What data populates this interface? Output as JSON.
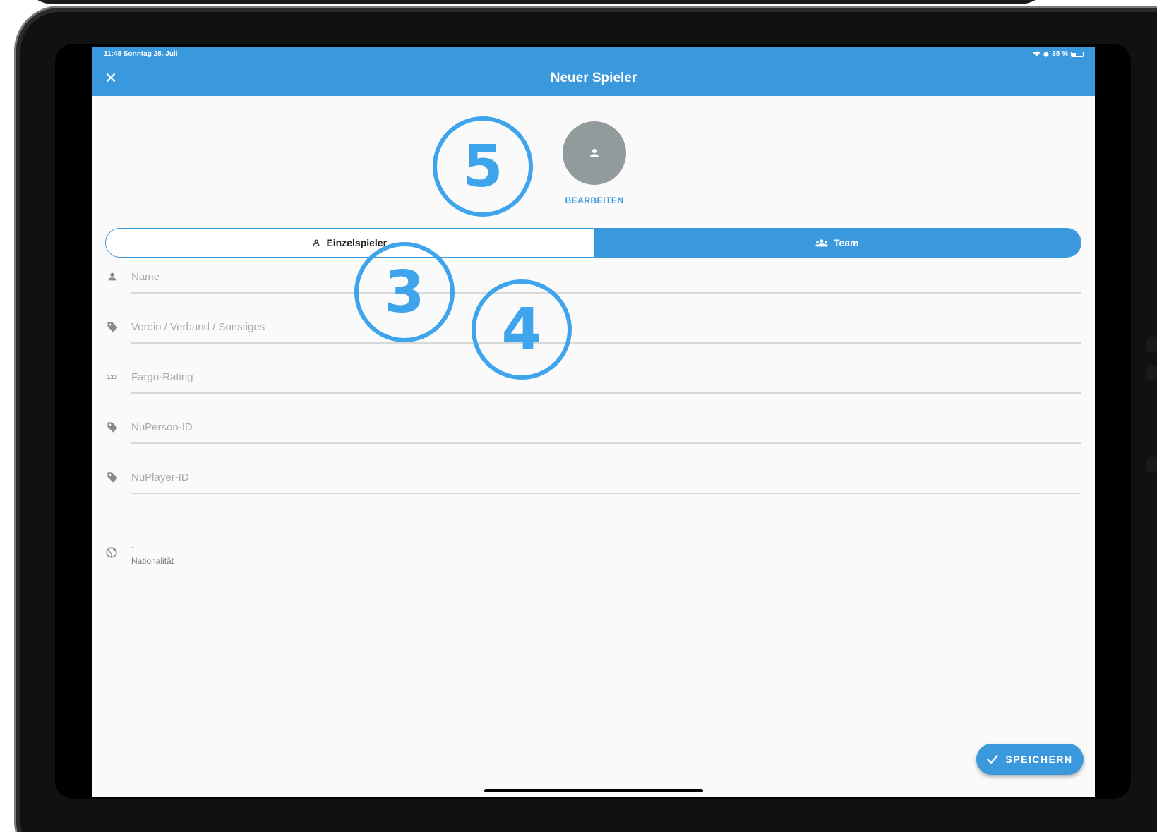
{
  "status_bar": {
    "time_date": "11:48 Sonntag 28. Juli",
    "battery": "38 %"
  },
  "app_bar": {
    "close_icon": "close-icon",
    "title": "Neuer Spieler"
  },
  "avatar": {
    "icon": "person-icon",
    "edit_label": "BEARBEITEN"
  },
  "segment": {
    "single_label": "Einzelspieler",
    "team_label": "Team",
    "selected": "Einzelspieler"
  },
  "form": {
    "fields": [
      {
        "icon": "person-icon",
        "placeholder": "Name"
      },
      {
        "icon": "tag-icon",
        "placeholder": "Verein / Verband / Sonstiges"
      },
      {
        "icon": "numbers-icon",
        "icon_text": "123",
        "placeholder": "Fargo-Rating"
      },
      {
        "icon": "tag-icon",
        "placeholder": "NuPerson-ID"
      },
      {
        "icon": "tag-icon",
        "placeholder": "NuPlayer-ID"
      }
    ],
    "nationality": {
      "icon": "globe-icon",
      "value": "-",
      "label": "Nationalität"
    }
  },
  "save_button": {
    "icon": "check-icon",
    "label": "SPEICHERN"
  },
  "callouts": [
    "5",
    "3",
    "4"
  ],
  "colors": {
    "primary": "#3a98dc",
    "callout": "#3ea4ec",
    "avatar_bg": "#919b9b"
  }
}
